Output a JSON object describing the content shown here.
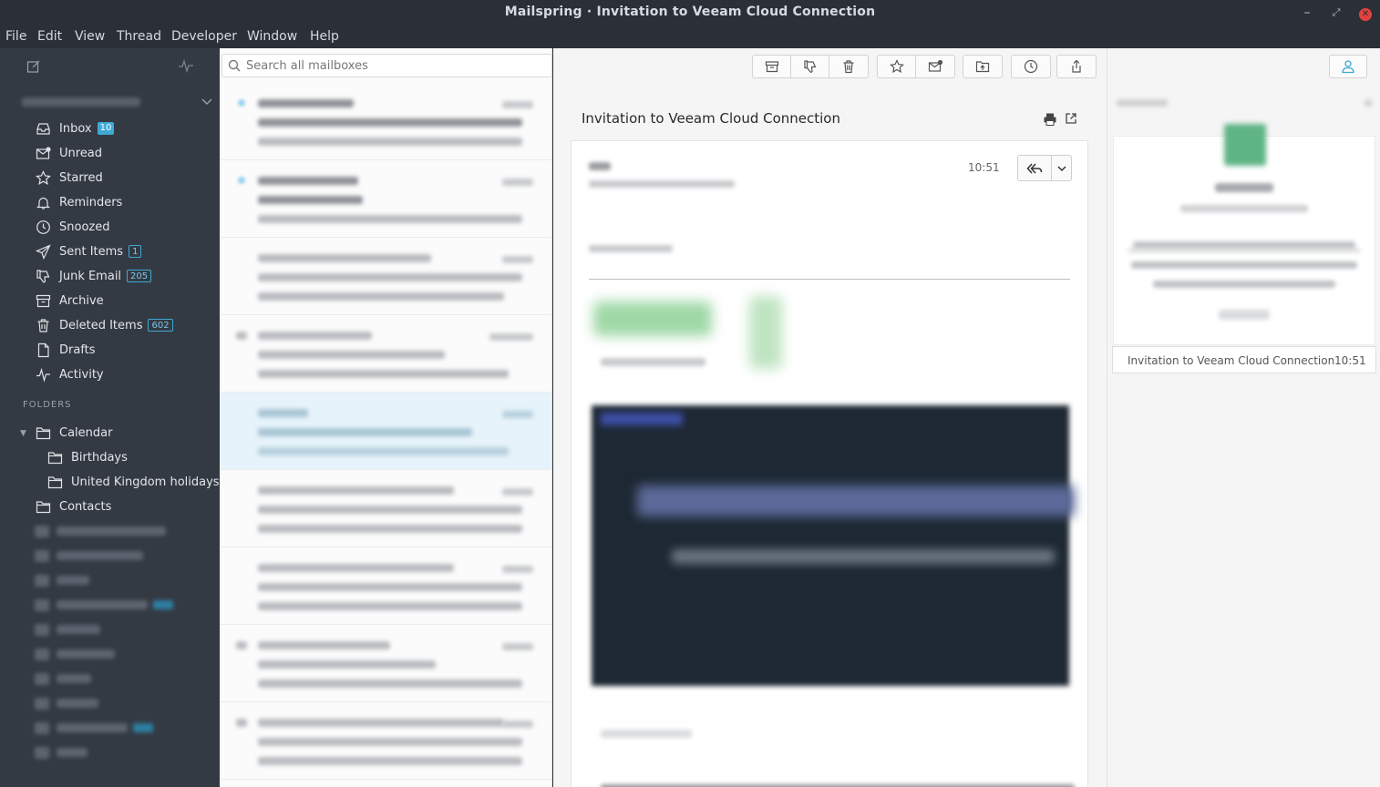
{
  "window": {
    "title": "Mailspring · Invitation to Veeam Cloud Connection",
    "controls": {
      "minimize": "–",
      "maximize": "⤢",
      "close": "✕"
    }
  },
  "menu": [
    "File",
    "Edit",
    "View",
    "Thread",
    "Developer",
    "Window",
    "Help"
  ],
  "sidebar": {
    "mailboxes": [
      {
        "label": "Inbox",
        "icon": "inbox-icon",
        "badge": "10",
        "badge_style": "solid"
      },
      {
        "label": "Unread",
        "icon": "unread-icon"
      },
      {
        "label": "Starred",
        "icon": "star-icon"
      },
      {
        "label": "Reminders",
        "icon": "bell-icon"
      },
      {
        "label": "Snoozed",
        "icon": "clock-icon"
      },
      {
        "label": "Sent Items",
        "icon": "send-icon",
        "badge": "1",
        "badge_style": "outline"
      },
      {
        "label": "Junk Email",
        "icon": "thumbs-down-icon",
        "badge": "205",
        "badge_style": "outline"
      },
      {
        "label": "Archive",
        "icon": "archive-icon"
      },
      {
        "label": "Deleted Items",
        "icon": "trash-icon",
        "badge": "602",
        "badge_style": "outline"
      },
      {
        "label": "Drafts",
        "icon": "draft-icon"
      },
      {
        "label": "Activity",
        "icon": "activity-icon"
      }
    ],
    "folders_label": "FOLDERS",
    "folders": [
      {
        "label": "Calendar",
        "expanded": true
      },
      {
        "label": "Birthdays"
      },
      {
        "label": "United Kingdom holidays"
      },
      {
        "label": "Contacts"
      }
    ]
  },
  "threadlist": {
    "search_placeholder": "Search all mailboxes"
  },
  "message": {
    "subject": "Invitation to Veeam Cloud Connection",
    "time": "10:51"
  },
  "rightbar": {
    "related_subject": "Invitation to Veeam Cloud Connection",
    "related_time": "10:51"
  },
  "colors": {
    "accent": "#3fa9d6",
    "chrome": "#2b3038",
    "sidebar": "#343a43"
  }
}
